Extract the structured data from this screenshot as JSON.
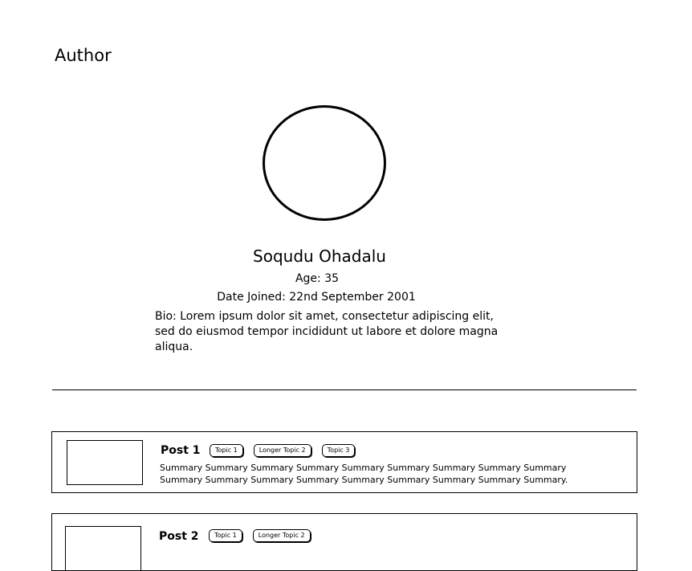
{
  "page": {
    "title": "Author"
  },
  "author": {
    "name": "Soqudu Ohadalu",
    "age": "Age: 35",
    "joined": "Date Joined: 22nd September 2001",
    "bio": "Bio: Lorem ipsum dolor sit amet, consectetur adipiscing elit, sed do eiusmod tempor incididunt ut labore et dolore magna aliqua."
  },
  "posts": [
    {
      "title": "Post 1",
      "topics": [
        "Topic 1",
        "Longer Topic 2",
        "Topic 3"
      ],
      "summary": "Summary Summary Summary Summary Summary Summary Summary Summary Summary Summary Summary Summary Summary Summary Summary Summary Summary Summary."
    },
    {
      "title": "Post 2",
      "topics": [
        "Topic 1",
        "Longer Topic 2"
      ]
    }
  ]
}
